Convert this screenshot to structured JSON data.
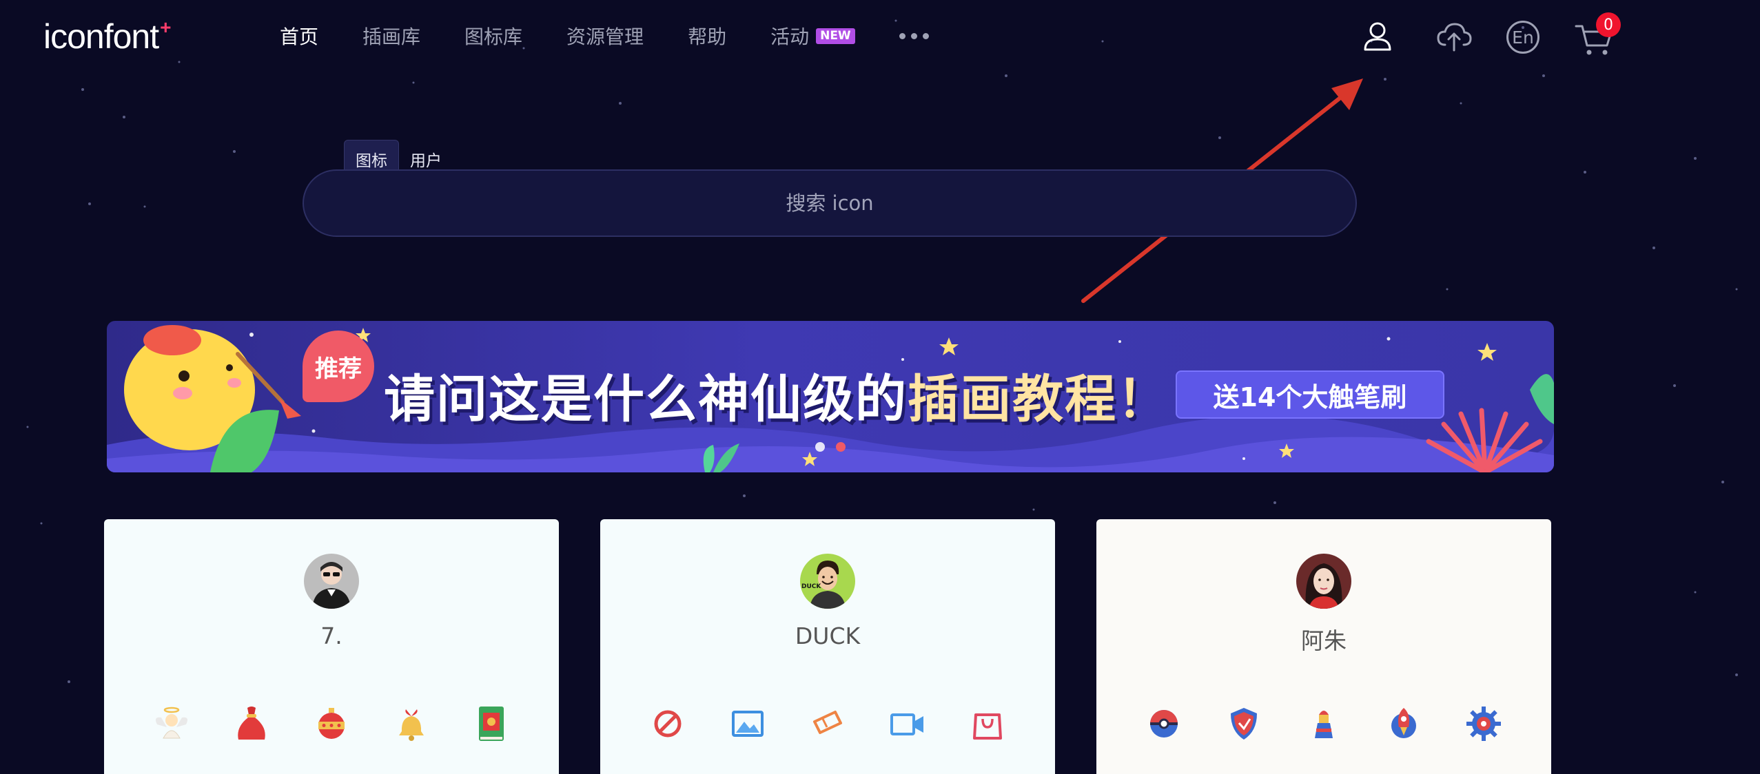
{
  "logo": {
    "text": "iconfont",
    "plus": "+"
  },
  "nav": {
    "items": [
      {
        "label": "首页",
        "active": true
      },
      {
        "label": "插画库"
      },
      {
        "label": "图标库"
      },
      {
        "label": "资源管理"
      },
      {
        "label": "帮助"
      },
      {
        "label": "活动",
        "badge": "NEW"
      }
    ]
  },
  "header_icons": {
    "user": "user-icon",
    "upload": "cloud-upload-icon",
    "lang": "En",
    "cart": "cart-icon",
    "cart_count": "0"
  },
  "search": {
    "tabs": [
      "图标",
      "用户"
    ],
    "active_tab": "图标",
    "placeholder": "搜索 icon"
  },
  "banner": {
    "tag": "推荐",
    "headline_main": "请问这是什么神仙级的",
    "headline_highlight": "插画教程！",
    "cta": "送14个大触笔刷"
  },
  "cards": [
    {
      "name": "7.",
      "icons": [
        "angel-icon",
        "gift-bag-icon",
        "ornament-icon",
        "bell-icon",
        "book-icon"
      ]
    },
    {
      "name": "DUCK",
      "icons": [
        "forbidden-icon",
        "image-icon",
        "ticket-icon",
        "video-icon",
        "shopping-bag-icon"
      ]
    },
    {
      "name": "阿朱",
      "icons": [
        "pokeball-icon",
        "shield-icon",
        "lighthouse-icon",
        "rocket-icon",
        "gear-icon"
      ]
    }
  ],
  "colors": {
    "background": "#0a0a24",
    "accent_red": "#f0142e",
    "annotation_arrow": "#d9372b",
    "new_badge": "#b14ee6"
  }
}
